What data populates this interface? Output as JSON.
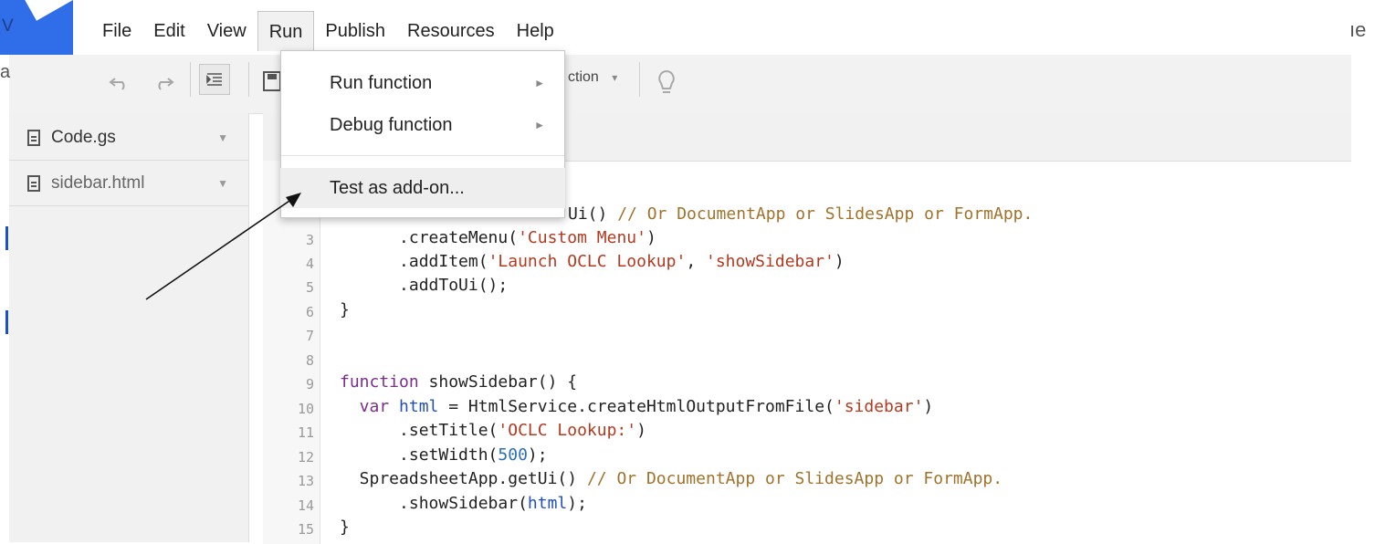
{
  "menubar": {
    "items": [
      {
        "label": "File"
      },
      {
        "label": "Edit"
      },
      {
        "label": "View"
      },
      {
        "label": "Run",
        "active": true
      },
      {
        "label": "Publish"
      },
      {
        "label": "Resources"
      },
      {
        "label": "Help"
      }
    ]
  },
  "partial_text": {
    "logo_letter": "V",
    "right_edge": "ıe",
    "left_edge": "a"
  },
  "run_menu": {
    "items": [
      {
        "label": "Run function",
        "submenu": true
      },
      {
        "label": "Debug function",
        "submenu": true
      },
      {
        "label": "Test as add-on...",
        "highlighted": true
      }
    ]
  },
  "toolbar": {
    "function_select_partial": "ction",
    "icons": [
      "undo-icon",
      "redo-icon",
      "indent-icon",
      "save-icon",
      "lightbulb-icon"
    ]
  },
  "files": [
    {
      "name": "Code.gs",
      "selected": true
    },
    {
      "name": "sidebar.html",
      "selected": false
    }
  ],
  "code": {
    "lines": [
      {
        "num": "3"
      },
      {
        "num": "4"
      },
      {
        "num": "5"
      },
      {
        "num": "6"
      },
      {
        "num": "7"
      },
      {
        "num": "8"
      },
      {
        "num": "9"
      },
      {
        "num": "10"
      },
      {
        "num": "11"
      },
      {
        "num": "12"
      },
      {
        "num": "13"
      },
      {
        "num": "14"
      },
      {
        "num": "15"
      }
    ],
    "partial_line_2": {
      "text_a": "Ui() ",
      "comment": "// Or DocumentApp or SlidesApp or FormApp."
    },
    "l3": {
      "a": "      .createMenu(",
      "s": "'Custom Menu'",
      "b": ")"
    },
    "l4": {
      "a": "      .addItem(",
      "s1": "'Launch OCLC Lookup'",
      "c": ", ",
      "s2": "'showSidebar'",
      "b": ")"
    },
    "l5": {
      "a": "      .addToUi();"
    },
    "l6": {
      "a": "}"
    },
    "l9": {
      "kw": "function",
      "a": " showSidebar() {"
    },
    "l10": {
      "kw": "  var ",
      "v": "html",
      "a": " = HtmlService.createHtmlOutputFromFile(",
      "s": "'sidebar'",
      "b": ")"
    },
    "l11": {
      "a": "      .setTitle(",
      "s": "'OCLC Lookup:'",
      "b": ")"
    },
    "l12": {
      "a": "      .setWidth(",
      "n": "500",
      "b": ");"
    },
    "l13": {
      "a": "  SpreadsheetApp.getUi() ",
      "cm": "// Or DocumentApp or SlidesApp or FormApp."
    },
    "l14": {
      "a": "      .showSidebar(",
      "v": "html",
      "b": ");"
    },
    "l15": {
      "a": "}"
    }
  },
  "colors": {
    "logo_blue": "#2f6ee8",
    "keyword": "#7a2d8a",
    "string": "#b3391f",
    "comment": "#a0722b",
    "number": "#2a6fb8"
  }
}
